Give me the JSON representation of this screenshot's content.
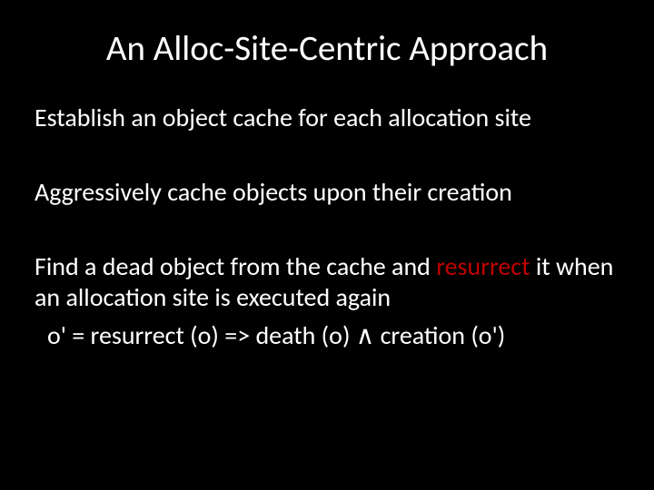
{
  "title": "An Alloc-Site-Centric Approach",
  "bullets": {
    "b1": "Establish an object cache for each allocation site",
    "b2": "Aggressively cache objects upon their creation",
    "b3_pre": "Find a dead object from the cache and ",
    "b3_red": "resurrect",
    "b3_post": " it when an allocation site is executed again"
  },
  "formula": {
    "lhs": "o' = resurrect (o) =>  death (o)  ",
    "and": "∧",
    "rhs": "  creation (o')"
  }
}
